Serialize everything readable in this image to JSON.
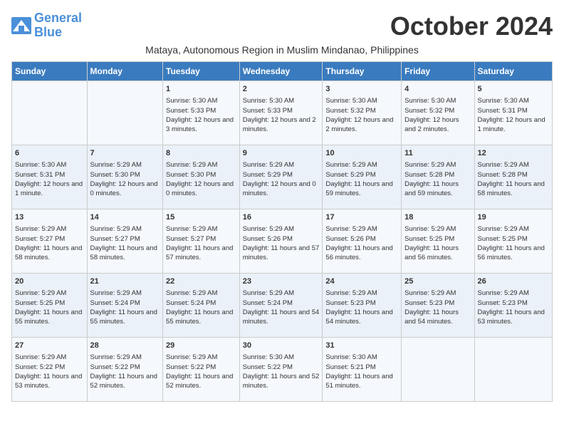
{
  "logo": {
    "text_general": "General",
    "text_blue": "Blue"
  },
  "title": "October 2024",
  "subtitle": "Mataya, Autonomous Region in Muslim Mindanao, Philippines",
  "headers": [
    "Sunday",
    "Monday",
    "Tuesday",
    "Wednesday",
    "Thursday",
    "Friday",
    "Saturday"
  ],
  "weeks": [
    [
      {
        "day": "",
        "info": ""
      },
      {
        "day": "",
        "info": ""
      },
      {
        "day": "1",
        "info": "Sunrise: 5:30 AM\nSunset: 5:33 PM\nDaylight: 12 hours and 3 minutes."
      },
      {
        "day": "2",
        "info": "Sunrise: 5:30 AM\nSunset: 5:33 PM\nDaylight: 12 hours and 2 minutes."
      },
      {
        "day": "3",
        "info": "Sunrise: 5:30 AM\nSunset: 5:32 PM\nDaylight: 12 hours and 2 minutes."
      },
      {
        "day": "4",
        "info": "Sunrise: 5:30 AM\nSunset: 5:32 PM\nDaylight: 12 hours and 2 minutes."
      },
      {
        "day": "5",
        "info": "Sunrise: 5:30 AM\nSunset: 5:31 PM\nDaylight: 12 hours and 1 minute."
      }
    ],
    [
      {
        "day": "6",
        "info": "Sunrise: 5:30 AM\nSunset: 5:31 PM\nDaylight: 12 hours and 1 minute."
      },
      {
        "day": "7",
        "info": "Sunrise: 5:29 AM\nSunset: 5:30 PM\nDaylight: 12 hours and 0 minutes."
      },
      {
        "day": "8",
        "info": "Sunrise: 5:29 AM\nSunset: 5:30 PM\nDaylight: 12 hours and 0 minutes."
      },
      {
        "day": "9",
        "info": "Sunrise: 5:29 AM\nSunset: 5:29 PM\nDaylight: 12 hours and 0 minutes."
      },
      {
        "day": "10",
        "info": "Sunrise: 5:29 AM\nSunset: 5:29 PM\nDaylight: 11 hours and 59 minutes."
      },
      {
        "day": "11",
        "info": "Sunrise: 5:29 AM\nSunset: 5:28 PM\nDaylight: 11 hours and 59 minutes."
      },
      {
        "day": "12",
        "info": "Sunrise: 5:29 AM\nSunset: 5:28 PM\nDaylight: 11 hours and 58 minutes."
      }
    ],
    [
      {
        "day": "13",
        "info": "Sunrise: 5:29 AM\nSunset: 5:27 PM\nDaylight: 11 hours and 58 minutes."
      },
      {
        "day": "14",
        "info": "Sunrise: 5:29 AM\nSunset: 5:27 PM\nDaylight: 11 hours and 58 minutes."
      },
      {
        "day": "15",
        "info": "Sunrise: 5:29 AM\nSunset: 5:27 PM\nDaylight: 11 hours and 57 minutes."
      },
      {
        "day": "16",
        "info": "Sunrise: 5:29 AM\nSunset: 5:26 PM\nDaylight: 11 hours and 57 minutes."
      },
      {
        "day": "17",
        "info": "Sunrise: 5:29 AM\nSunset: 5:26 PM\nDaylight: 11 hours and 56 minutes."
      },
      {
        "day": "18",
        "info": "Sunrise: 5:29 AM\nSunset: 5:25 PM\nDaylight: 11 hours and 56 minutes."
      },
      {
        "day": "19",
        "info": "Sunrise: 5:29 AM\nSunset: 5:25 PM\nDaylight: 11 hours and 56 minutes."
      }
    ],
    [
      {
        "day": "20",
        "info": "Sunrise: 5:29 AM\nSunset: 5:25 PM\nDaylight: 11 hours and 55 minutes."
      },
      {
        "day": "21",
        "info": "Sunrise: 5:29 AM\nSunset: 5:24 PM\nDaylight: 11 hours and 55 minutes."
      },
      {
        "day": "22",
        "info": "Sunrise: 5:29 AM\nSunset: 5:24 PM\nDaylight: 11 hours and 55 minutes."
      },
      {
        "day": "23",
        "info": "Sunrise: 5:29 AM\nSunset: 5:24 PM\nDaylight: 11 hours and 54 minutes."
      },
      {
        "day": "24",
        "info": "Sunrise: 5:29 AM\nSunset: 5:23 PM\nDaylight: 11 hours and 54 minutes."
      },
      {
        "day": "25",
        "info": "Sunrise: 5:29 AM\nSunset: 5:23 PM\nDaylight: 11 hours and 54 minutes."
      },
      {
        "day": "26",
        "info": "Sunrise: 5:29 AM\nSunset: 5:23 PM\nDaylight: 11 hours and 53 minutes."
      }
    ],
    [
      {
        "day": "27",
        "info": "Sunrise: 5:29 AM\nSunset: 5:22 PM\nDaylight: 11 hours and 53 minutes."
      },
      {
        "day": "28",
        "info": "Sunrise: 5:29 AM\nSunset: 5:22 PM\nDaylight: 11 hours and 52 minutes."
      },
      {
        "day": "29",
        "info": "Sunrise: 5:29 AM\nSunset: 5:22 PM\nDaylight: 11 hours and 52 minutes."
      },
      {
        "day": "30",
        "info": "Sunrise: 5:30 AM\nSunset: 5:22 PM\nDaylight: 11 hours and 52 minutes."
      },
      {
        "day": "31",
        "info": "Sunrise: 5:30 AM\nSunset: 5:21 PM\nDaylight: 11 hours and 51 minutes."
      },
      {
        "day": "",
        "info": ""
      },
      {
        "day": "",
        "info": ""
      }
    ]
  ]
}
